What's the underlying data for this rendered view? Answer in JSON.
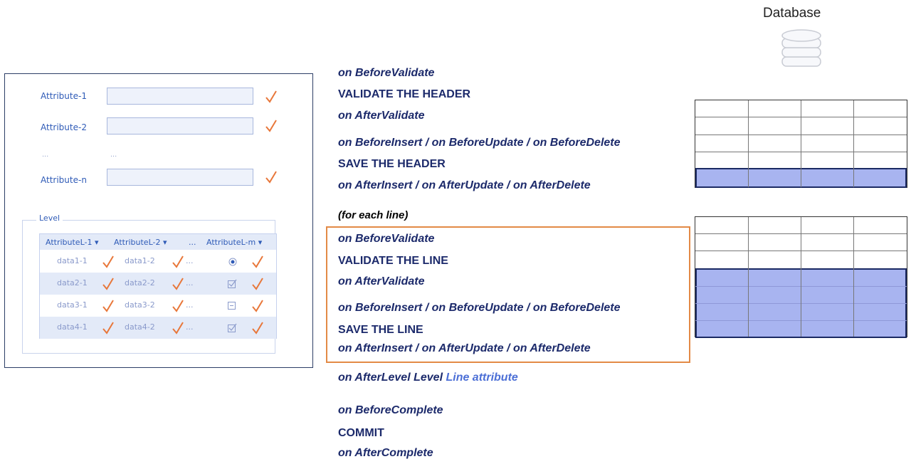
{
  "form": {
    "attributes": [
      {
        "label": "Attribute-1"
      },
      {
        "label": "Attribute-2"
      },
      {
        "label": "Attribute-n"
      }
    ],
    "ellipsis": "...",
    "level_label": "Level",
    "grid": {
      "headers": [
        "AttributeL-1",
        "AttributeL-2",
        "...",
        "AttributeL-m"
      ],
      "rows": [
        {
          "c1": "data1-1",
          "c2": "data1-2",
          "control": "radio-icon"
        },
        {
          "c1": "data2-1",
          "c2": "data2-2",
          "control": "checkbox-checked-icon"
        },
        {
          "c1": "data3-1",
          "c2": "data3-2",
          "control": "checkbox-indeterminate-icon"
        },
        {
          "c1": "data4-1",
          "c2": "data4-2",
          "control": "checkbox-checked-icon"
        }
      ],
      "row_ellipsis": "..."
    }
  },
  "events": {
    "header_before_validate": "on BeforeValidate",
    "validate_header": "VALIDATE THE HEADER",
    "header_after_validate": "on AfterValidate",
    "header_before_ops": "on BeforeInsert / on BeforeUpdate / on BeforeDelete",
    "save_header": "SAVE THE HEADER",
    "header_after_ops": "on AfterInsert  / on AfterUpdate / on AfterDelete",
    "for_each_line": "(for each line)",
    "line_before_validate": "on BeforeValidate",
    "validate_line": "VALIDATE THE LINE",
    "line_after_validate": "on AfterValidate",
    "line_before_ops": "on BeforeInsert / on BeforeUpdate / on BeforeDelete",
    "save_line": "SAVE THE LINE",
    "line_after_ops": "on AfterInsert  / on AfterUpdate / on AfterDelete",
    "after_level": "on AfterLevel Level",
    "after_level_attr": "Line attribute",
    "before_complete": "on BeforeComplete",
    "commit": "COMMIT",
    "after_complete": "on AfterComplete"
  },
  "database": {
    "title": "Database",
    "icon": "database-icon"
  },
  "colors": {
    "check": "#e8773a",
    "highlight": "#e38a46",
    "navy": "#1c2a6b",
    "db_fill": "#a8b4f0"
  }
}
